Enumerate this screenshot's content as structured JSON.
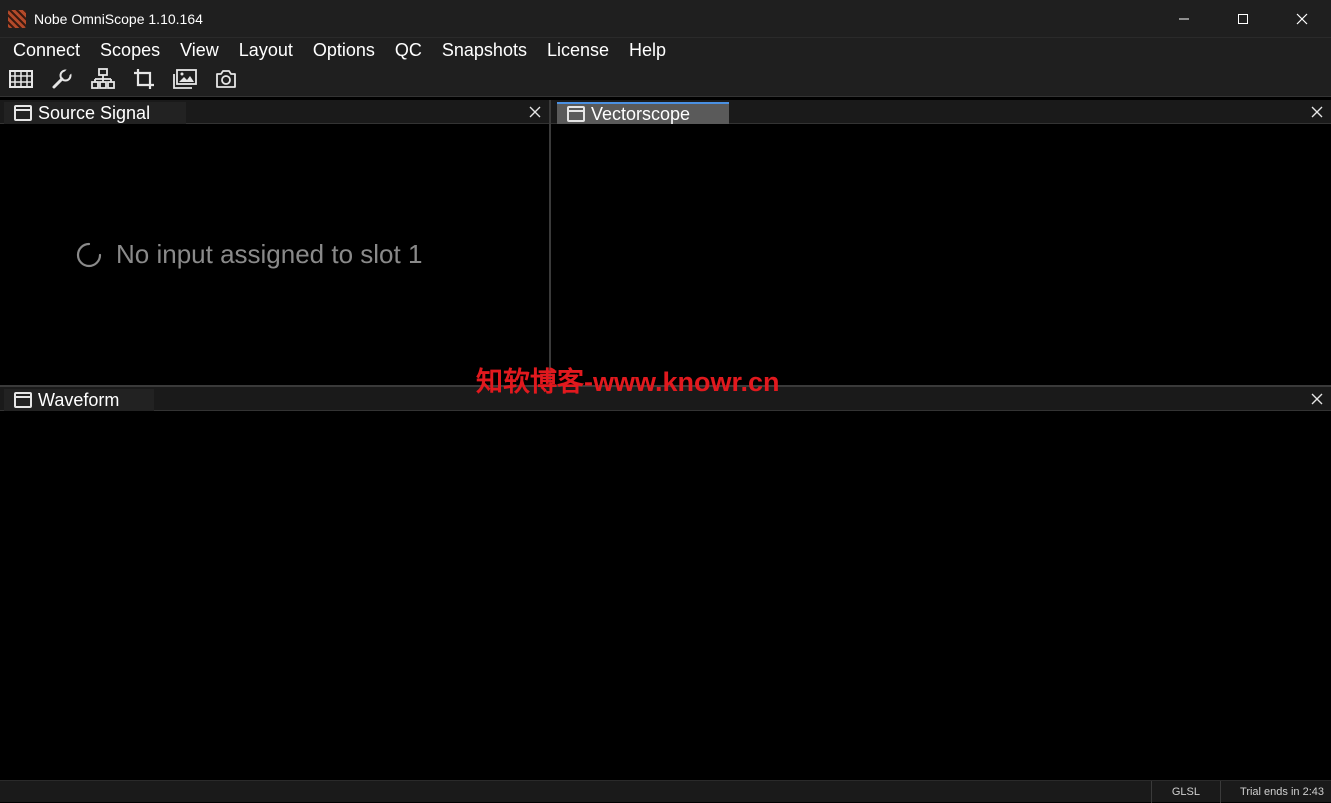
{
  "window": {
    "title": "Nobe OmniScope 1.10.164",
    "controls": [
      "minimize-icon",
      "maximize-icon",
      "close-icon"
    ]
  },
  "menu": {
    "items": [
      "Connect",
      "Scopes",
      "View",
      "Layout",
      "Options",
      "QC",
      "Snapshots",
      "License",
      "Help"
    ]
  },
  "toolbar": {
    "icons": [
      "timeline-icon",
      "wrench-icon",
      "network-icon",
      "crop-icon",
      "gallery-icon",
      "camera-icon"
    ]
  },
  "panels": {
    "source": {
      "title": "Source Signal",
      "message": "No input assigned to slot 1"
    },
    "vectorscope": {
      "title": "Vectorscope"
    },
    "waveform": {
      "title": "Waveform"
    }
  },
  "watermark": "知软博客-www.knowr.cn",
  "status": {
    "renderer": "GLSL",
    "trial": "Trial ends in 2:43"
  },
  "colors": {
    "accent": "#4a90e2",
    "watermark": "#e1191e",
    "chrome": "#1f1f1f"
  }
}
